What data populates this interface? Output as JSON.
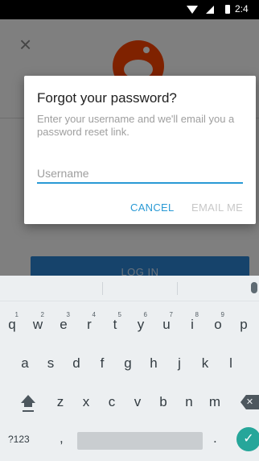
{
  "status_bar": {
    "time": "2:4"
  },
  "background": {
    "close_glyph": "×",
    "login_label": "LOG IN",
    "logo_icon": "reddit-logo-icon"
  },
  "dialog": {
    "title": "Forgot your password?",
    "message": "Enter your username and we'll email you a password reset link.",
    "username_placeholder": "Username",
    "username_value": "",
    "cancel_label": "CANCEL",
    "email_label": "EMAIL ME"
  },
  "keyboard": {
    "row1": [
      "q",
      "w",
      "e",
      "r",
      "t",
      "y",
      "u",
      "i",
      "o",
      "p"
    ],
    "row1_hints": [
      "1",
      "2",
      "3",
      "4",
      "5",
      "6",
      "7",
      "8",
      "9",
      ""
    ],
    "row2": [
      "a",
      "s",
      "d",
      "f",
      "g",
      "h",
      "j",
      "k",
      "l"
    ],
    "row3": [
      "z",
      "x",
      "c",
      "v",
      "b",
      "n",
      "m"
    ],
    "symbols_label": "?123",
    "comma": ",",
    "period": ".",
    "enter_glyph": "✓",
    "backspace_glyph": "✕"
  },
  "colors": {
    "accent": "#2a9ad5",
    "reddit_orange": "#ff4500",
    "enter": "#26a69a"
  }
}
